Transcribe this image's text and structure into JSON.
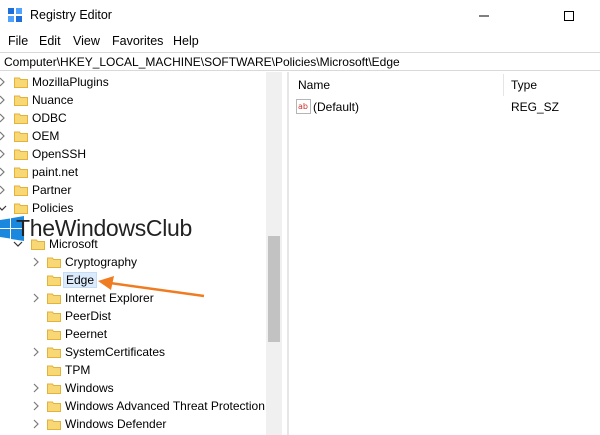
{
  "window": {
    "title": "Registry Editor"
  },
  "menu": [
    "File",
    "Edit",
    "View",
    "Favorites",
    "Help"
  ],
  "address": "Computer\\HKEY_LOCAL_MACHINE\\SOFTWARE\\Policies\\Microsoft\\Edge",
  "tree": {
    "items": [
      {
        "label": "MozillaPlugins"
      },
      {
        "label": "Nuance"
      },
      {
        "label": "ODBC"
      },
      {
        "label": "OEM"
      },
      {
        "label": "OpenSSH"
      },
      {
        "label": "paint.net"
      },
      {
        "label": "Partner"
      },
      {
        "label": "Policies"
      },
      {
        "label": "Microsoft"
      },
      {
        "label": "Cryptography"
      },
      {
        "label": "Edge"
      },
      {
        "label": "Internet Explorer"
      },
      {
        "label": "PeerDist"
      },
      {
        "label": "Peernet"
      },
      {
        "label": "SystemCertificates"
      },
      {
        "label": "TPM"
      },
      {
        "label": "Windows"
      },
      {
        "label": "Windows Advanced Threat Protection"
      },
      {
        "label": "Windows Defender"
      }
    ]
  },
  "values_pane": {
    "columns": {
      "name": "Name",
      "type": "Type"
    },
    "rows": [
      {
        "name": "(Default)",
        "type": "REG_SZ",
        "icon": "ab-string-icon"
      }
    ]
  },
  "watermark": {
    "text": "TheWindowsClub"
  },
  "colors": {
    "folder": "#f8d775",
    "folder_dark": "#e3b23c",
    "selection": "#dcebfc",
    "arrow": "#f07c22",
    "chevron": "#7a7a7a"
  }
}
